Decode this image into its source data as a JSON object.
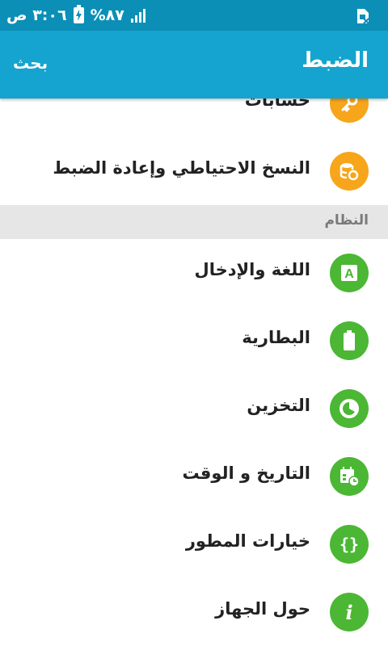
{
  "status_bar": {
    "time": "٣:٠٦ ص",
    "battery": "%٨٧",
    "icons": [
      "battery-charging-icon",
      "signal-icon",
      "sim-card-icon"
    ]
  },
  "app_bar": {
    "title": "الضبط",
    "search_label": "بحث"
  },
  "items_top": [
    {
      "label": "حسابات",
      "icon": "key-icon",
      "color": "#f7a51a"
    },
    {
      "label": "النسخ الاحتياطي وإعادة الضبط",
      "icon": "backup-restore-icon",
      "color": "#f7a51a"
    }
  ],
  "section": {
    "title": "النظام"
  },
  "system_items": [
    {
      "label": "اللغة والإدخال",
      "icon": "language-input-icon",
      "color": "#4bb734"
    },
    {
      "label": "البطارية",
      "icon": "battery-icon",
      "color": "#4bb734"
    },
    {
      "label": "التخزين",
      "icon": "storage-icon",
      "color": "#4bb734"
    },
    {
      "label": "التاريخ و الوقت",
      "icon": "calendar-clock-icon",
      "color": "#4bb734"
    },
    {
      "label": "خيارات المطور",
      "icon": "developer-braces-icon",
      "color": "#4bb734"
    },
    {
      "label": "حول الجهاز",
      "icon": "info-icon",
      "color": "#4bb734"
    }
  ]
}
